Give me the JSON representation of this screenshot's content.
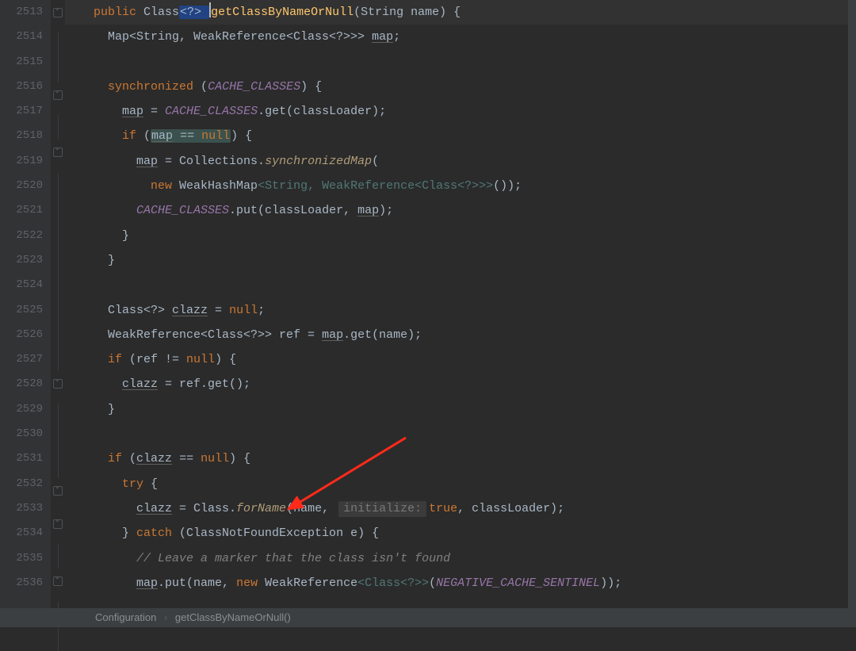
{
  "line_start": 2513,
  "lines": [
    {
      "n": 2513
    },
    {
      "n": 2514
    },
    {
      "n": 2515
    },
    {
      "n": 2516
    },
    {
      "n": 2517
    },
    {
      "n": 2518
    },
    {
      "n": 2519
    },
    {
      "n": 2520
    },
    {
      "n": 2521
    },
    {
      "n": 2522
    },
    {
      "n": 2523
    },
    {
      "n": 2524
    },
    {
      "n": 2525
    },
    {
      "n": 2526
    },
    {
      "n": 2527
    },
    {
      "n": 2528
    },
    {
      "n": 2529
    },
    {
      "n": 2530
    },
    {
      "n": 2531
    },
    {
      "n": 2532
    },
    {
      "n": 2533
    },
    {
      "n": 2534
    },
    {
      "n": 2535
    },
    {
      "n": 2536
    }
  ],
  "code": {
    "l2513_pre": "    ",
    "l2513_kw": "public ",
    "l2513_type": "Class",
    "l2513_gen": "<?> ",
    "l2513_fn": "getClassByNameOrNull",
    "l2513_sig": "(String name) {",
    "l2514": "      Map<String, WeakReference<Class<?>>> ",
    "l2514_var": "map",
    "l2514_end": ";",
    "l2516_pre": "      ",
    "l2516_kw": "synchronized ",
    "l2516_open": "(",
    "l2516_field": "CACHE_CLASSES",
    "l2516_end": ") {",
    "l2517_pre": "        ",
    "l2517_var": "map",
    "l2517_mid": " = ",
    "l2517_field": "CACHE_CLASSES",
    "l2517_call": ".get(classLoader);",
    "l2518_pre": "        ",
    "l2518_kw": "if ",
    "l2518_open": "(",
    "l2518_var": "map",
    "l2518_eq": " == ",
    "l2518_null": "null",
    "l2518_end": ") {",
    "l2519_pre": "          ",
    "l2519_var": "map",
    "l2519_mid": " = Collections.",
    "l2519_fn": "synchronizedMap",
    "l2519_end": "(",
    "l2520_pre": "            ",
    "l2520_kw": "new ",
    "l2520_type": "WeakHashMap",
    "l2520_gen": "<String, WeakReference<Class<?>>>",
    "l2520_end": "());",
    "l2521_pre": "          ",
    "l2521_field": "CACHE_CLASSES",
    "l2521_mid": ".put(classLoader, ",
    "l2521_var": "map",
    "l2521_end": ");",
    "l2522": "        }",
    "l2523": "      }",
    "l2525_pre": "      Class<?> ",
    "l2525_var": "clazz",
    "l2525_mid": " = ",
    "l2525_null": "null",
    "l2525_end": ";",
    "l2526_pre": "      WeakReference<Class<?>> ref = ",
    "l2526_var": "map",
    "l2526_end": ".get(name);",
    "l2527_pre": "      ",
    "l2527_kw": "if ",
    "l2527_cond": "(ref != ",
    "l2527_null": "null",
    "l2527_end": ") {",
    "l2528_pre": "        ",
    "l2528_var": "clazz",
    "l2528_end": " = ref.get();",
    "l2529": "      }",
    "l2531_pre": "      ",
    "l2531_kw": "if ",
    "l2531_open": "(",
    "l2531_var": "clazz",
    "l2531_eq": " == ",
    "l2531_null": "null",
    "l2531_end": ") {",
    "l2532_pre": "        ",
    "l2532_kw": "try ",
    "l2532_end": "{",
    "l2533_pre": "          ",
    "l2533_var": "clazz",
    "l2533_mid": " = Class.",
    "l2533_fn": "forName",
    "l2533_open": "(name, ",
    "l2533_hint": "initialize:",
    "l2533_true": "true",
    "l2533_end": ", classLoader);",
    "l2534_pre": "        } ",
    "l2534_kw": "catch ",
    "l2534_end": "(ClassNotFoundException e) {",
    "l2535_pre": "          ",
    "l2535_comment": "// Leave a marker that the class isn't found",
    "l2536_pre": "          ",
    "l2536_var": "map",
    "l2536_mid": ".put(name, ",
    "l2536_kw": "new ",
    "l2536_type": "WeakReference",
    "l2536_gen": "<Class<?>>",
    "l2536_open": "(",
    "l2536_field": "NEGATIVE_CACHE_SENTINEL",
    "l2536_end": "));"
  },
  "breadcrumb": {
    "cls": "Configuration",
    "mtd": "getClassByNameOrNull()"
  }
}
